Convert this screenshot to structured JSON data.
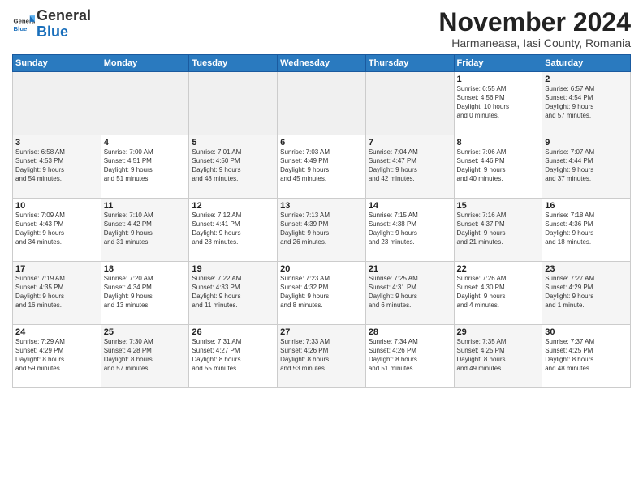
{
  "header": {
    "logo_general": "General",
    "logo_blue": "Blue",
    "month_title": "November 2024",
    "subtitle": "Harmaneasa, Iasi County, Romania"
  },
  "weekdays": [
    "Sunday",
    "Monday",
    "Tuesday",
    "Wednesday",
    "Thursday",
    "Friday",
    "Saturday"
  ],
  "weeks": [
    [
      {
        "day": "",
        "empty": true
      },
      {
        "day": "",
        "empty": true
      },
      {
        "day": "",
        "empty": true
      },
      {
        "day": "",
        "empty": true
      },
      {
        "day": "",
        "empty": true
      },
      {
        "day": "1",
        "info": "Sunrise: 6:55 AM\nSunset: 4:56 PM\nDaylight: 10 hours\nand 0 minutes.",
        "shaded": false
      },
      {
        "day": "2",
        "info": "Sunrise: 6:57 AM\nSunset: 4:54 PM\nDaylight: 9 hours\nand 57 minutes.",
        "shaded": true
      }
    ],
    [
      {
        "day": "3",
        "info": "Sunrise: 6:58 AM\nSunset: 4:53 PM\nDaylight: 9 hours\nand 54 minutes.",
        "shaded": true
      },
      {
        "day": "4",
        "info": "Sunrise: 7:00 AM\nSunset: 4:51 PM\nDaylight: 9 hours\nand 51 minutes.",
        "shaded": false
      },
      {
        "day": "5",
        "info": "Sunrise: 7:01 AM\nSunset: 4:50 PM\nDaylight: 9 hours\nand 48 minutes.",
        "shaded": true
      },
      {
        "day": "6",
        "info": "Sunrise: 7:03 AM\nSunset: 4:49 PM\nDaylight: 9 hours\nand 45 minutes.",
        "shaded": false
      },
      {
        "day": "7",
        "info": "Sunrise: 7:04 AM\nSunset: 4:47 PM\nDaylight: 9 hours\nand 42 minutes.",
        "shaded": true
      },
      {
        "day": "8",
        "info": "Sunrise: 7:06 AM\nSunset: 4:46 PM\nDaylight: 9 hours\nand 40 minutes.",
        "shaded": false
      },
      {
        "day": "9",
        "info": "Sunrise: 7:07 AM\nSunset: 4:44 PM\nDaylight: 9 hours\nand 37 minutes.",
        "shaded": true
      }
    ],
    [
      {
        "day": "10",
        "info": "Sunrise: 7:09 AM\nSunset: 4:43 PM\nDaylight: 9 hours\nand 34 minutes.",
        "shaded": false
      },
      {
        "day": "11",
        "info": "Sunrise: 7:10 AM\nSunset: 4:42 PM\nDaylight: 9 hours\nand 31 minutes.",
        "shaded": true
      },
      {
        "day": "12",
        "info": "Sunrise: 7:12 AM\nSunset: 4:41 PM\nDaylight: 9 hours\nand 28 minutes.",
        "shaded": false
      },
      {
        "day": "13",
        "info": "Sunrise: 7:13 AM\nSunset: 4:39 PM\nDaylight: 9 hours\nand 26 minutes.",
        "shaded": true
      },
      {
        "day": "14",
        "info": "Sunrise: 7:15 AM\nSunset: 4:38 PM\nDaylight: 9 hours\nand 23 minutes.",
        "shaded": false
      },
      {
        "day": "15",
        "info": "Sunrise: 7:16 AM\nSunset: 4:37 PM\nDaylight: 9 hours\nand 21 minutes.",
        "shaded": true
      },
      {
        "day": "16",
        "info": "Sunrise: 7:18 AM\nSunset: 4:36 PM\nDaylight: 9 hours\nand 18 minutes.",
        "shaded": false
      }
    ],
    [
      {
        "day": "17",
        "info": "Sunrise: 7:19 AM\nSunset: 4:35 PM\nDaylight: 9 hours\nand 16 minutes.",
        "shaded": true
      },
      {
        "day": "18",
        "info": "Sunrise: 7:20 AM\nSunset: 4:34 PM\nDaylight: 9 hours\nand 13 minutes.",
        "shaded": false
      },
      {
        "day": "19",
        "info": "Sunrise: 7:22 AM\nSunset: 4:33 PM\nDaylight: 9 hours\nand 11 minutes.",
        "shaded": true
      },
      {
        "day": "20",
        "info": "Sunrise: 7:23 AM\nSunset: 4:32 PM\nDaylight: 9 hours\nand 8 minutes.",
        "shaded": false
      },
      {
        "day": "21",
        "info": "Sunrise: 7:25 AM\nSunset: 4:31 PM\nDaylight: 9 hours\nand 6 minutes.",
        "shaded": true
      },
      {
        "day": "22",
        "info": "Sunrise: 7:26 AM\nSunset: 4:30 PM\nDaylight: 9 hours\nand 4 minutes.",
        "shaded": false
      },
      {
        "day": "23",
        "info": "Sunrise: 7:27 AM\nSunset: 4:29 PM\nDaylight: 9 hours\nand 1 minute.",
        "shaded": true
      }
    ],
    [
      {
        "day": "24",
        "info": "Sunrise: 7:29 AM\nSunset: 4:29 PM\nDaylight: 8 hours\nand 59 minutes.",
        "shaded": false
      },
      {
        "day": "25",
        "info": "Sunrise: 7:30 AM\nSunset: 4:28 PM\nDaylight: 8 hours\nand 57 minutes.",
        "shaded": true
      },
      {
        "day": "26",
        "info": "Sunrise: 7:31 AM\nSunset: 4:27 PM\nDaylight: 8 hours\nand 55 minutes.",
        "shaded": false
      },
      {
        "day": "27",
        "info": "Sunrise: 7:33 AM\nSunset: 4:26 PM\nDaylight: 8 hours\nand 53 minutes.",
        "shaded": true
      },
      {
        "day": "28",
        "info": "Sunrise: 7:34 AM\nSunset: 4:26 PM\nDaylight: 8 hours\nand 51 minutes.",
        "shaded": false
      },
      {
        "day": "29",
        "info": "Sunrise: 7:35 AM\nSunset: 4:25 PM\nDaylight: 8 hours\nand 49 minutes.",
        "shaded": true
      },
      {
        "day": "30",
        "info": "Sunrise: 7:37 AM\nSunset: 4:25 PM\nDaylight: 8 hours\nand 48 minutes.",
        "shaded": false
      }
    ]
  ]
}
